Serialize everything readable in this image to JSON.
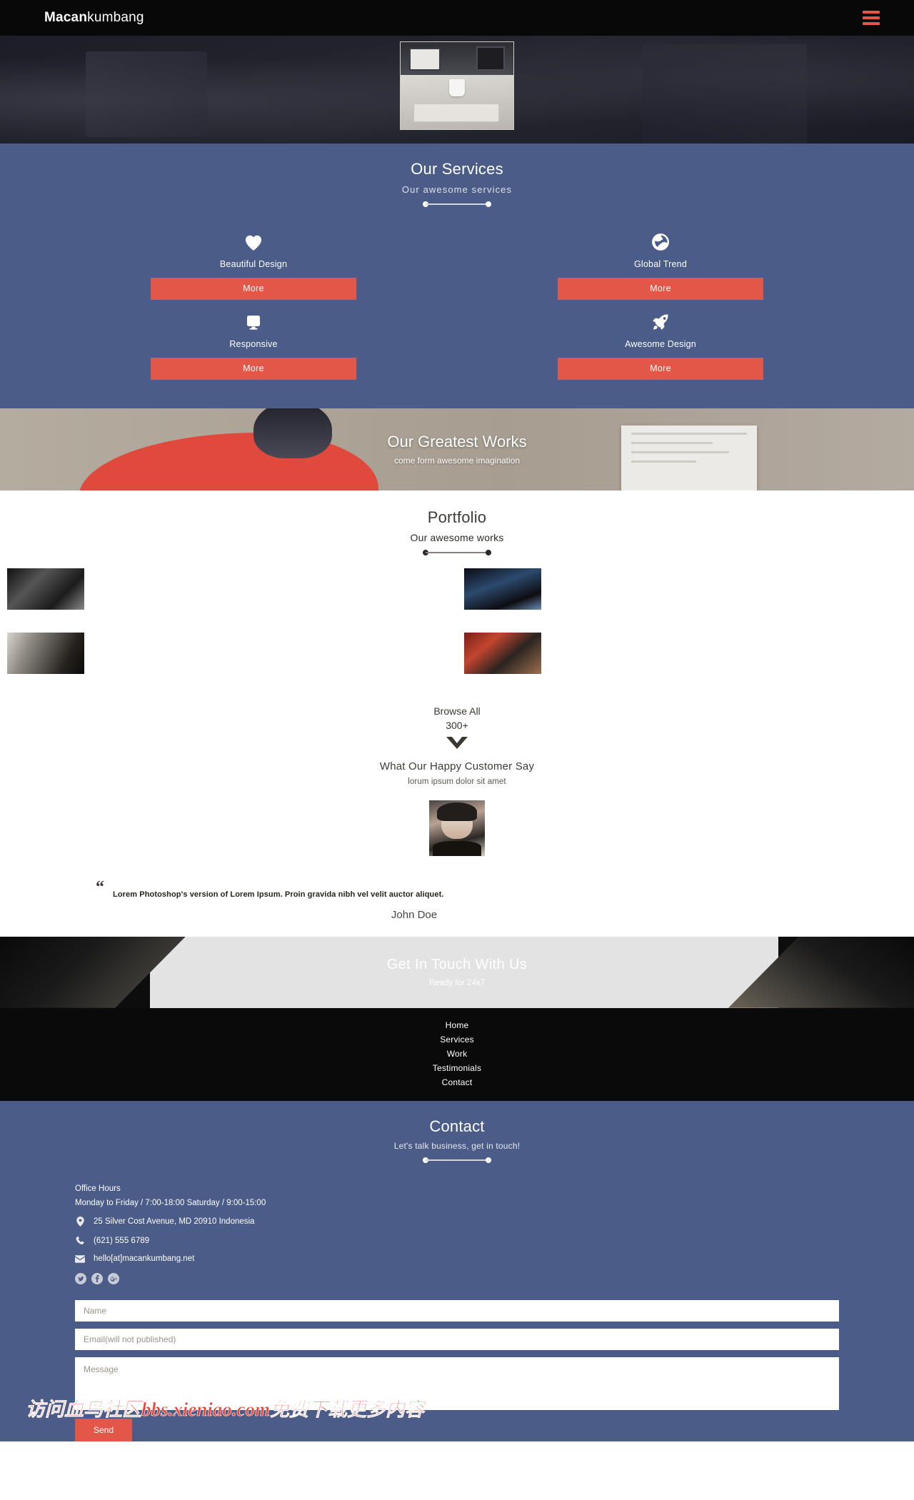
{
  "brand": {
    "bold": "Macan",
    "light": "kumbang"
  },
  "topbar": {
    "menu_icon": "hamburger-menu-icon"
  },
  "hero": {
    "image_alt": "office-desk-photo"
  },
  "services": {
    "title": "Our Services",
    "subtitle": "Our awesome services",
    "items": [
      {
        "icon": "heart-icon",
        "label": "Beautiful Design",
        "button": "More"
      },
      {
        "icon": "globe-icon",
        "label": "Global Trend",
        "button": "More"
      },
      {
        "icon": "monitor-icon",
        "label": "Responsive",
        "button": "More"
      },
      {
        "icon": "rocket-icon",
        "label": "Awesome Design",
        "button": "More"
      }
    ],
    "bg_color": "#4a5c87",
    "accent_color": "#e25747"
  },
  "works_banner": {
    "title": "Our Greatest Works",
    "subtitle": "come form awesome imagination"
  },
  "portfolio": {
    "title": "Portfolio",
    "subtitle": "Our awesome works",
    "items": [
      {
        "name": "portfolio-thumb-1"
      },
      {
        "name": "portfolio-thumb-2"
      },
      {
        "name": "portfolio-thumb-3"
      },
      {
        "name": "portfolio-thumb-4"
      }
    ],
    "browse_label": "Browse All",
    "browse_count": "300+",
    "chevron_icon": "chevron-down-icon"
  },
  "testimonials": {
    "title": "What Our Happy Customer Say",
    "subtitle": "lorum ipsum dolor sit amet",
    "avatar_alt": "customer-avatar-photo",
    "quote_mark": "“",
    "quote": "Lorem Photoshop's version of Lorem Ipsum. Proin gravida nibh vel velit auctor aliquet.",
    "author": "John Doe"
  },
  "get_in_touch": {
    "title": "Get In Touch With Us",
    "subtitle": "Ready for 24x7"
  },
  "footer_nav": {
    "links": [
      "Home",
      "Services",
      "Work",
      "Testimonials",
      "Contact"
    ]
  },
  "contact": {
    "title": "Contact",
    "subtitle": "Let's talk business, get in touch!",
    "office_hours_title": "Office Hours",
    "office_hours_line": "Monday to Friday / 7:00-18:00 Saturday / 9:00-15:00",
    "address": "25 Silver Cost Avenue, MD 20910 Indonesia",
    "phone": "(621) 555 6789",
    "email": "hello[at]macankumbang.net",
    "socials": [
      {
        "icon": "twitter-icon",
        "glyph": "t"
      },
      {
        "icon": "facebook-icon",
        "glyph": "f"
      },
      {
        "icon": "google-plus-icon",
        "glyph": "g"
      }
    ],
    "form": {
      "name_placeholder": "Name",
      "email_placeholder": "Email(will not published)",
      "message_placeholder": "Message",
      "name_value": "",
      "email_value": "",
      "message_value": "",
      "send_label": "Send"
    }
  },
  "watermark": {
    "text": "访问血鸟社区bbs.xieniao.com免费下载更多内容"
  }
}
